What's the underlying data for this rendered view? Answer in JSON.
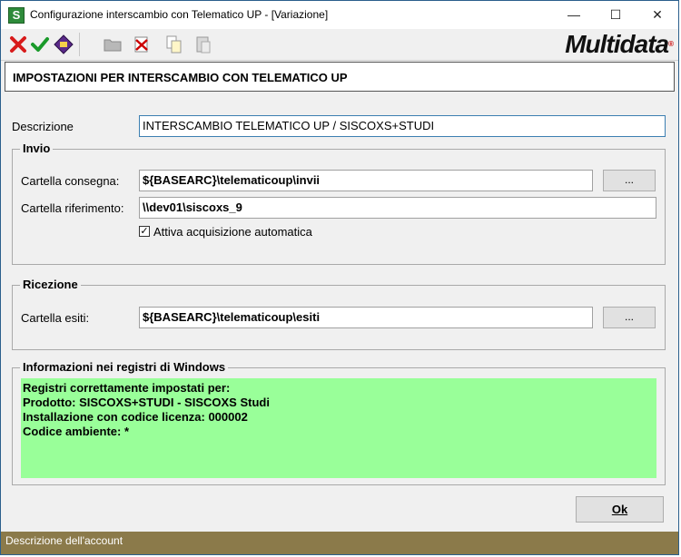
{
  "window": {
    "title": "Configurazione interscambio con Telematico UP - [Variazione]",
    "app_icon": "S",
    "minimize_glyph": "—",
    "maximize_glyph": "☐",
    "close_glyph": "✕"
  },
  "toolbar": {
    "icons": [
      "cancel-icon",
      "confirm-icon",
      "edit-icon",
      "folder-icon",
      "delete-icon",
      "copy-icon",
      "paste-icon"
    ],
    "logo": "Multidata",
    "logo_reg": "®"
  },
  "header": {
    "title": "IMPOSTAZIONI PER INTERSCAMBIO CON TELEMATICO UP"
  },
  "descrizione": {
    "label": "Descrizione",
    "value": "INTERSCAMBIO TELEMATICO UP / SISCOXS+STUDI"
  },
  "invio": {
    "title": "Invio",
    "consegna_label": "Cartella consegna:",
    "consegna_value": "${BASEARC}\\telematicoup\\invii",
    "browse_label": "...",
    "riferimento_label": "Cartella riferimento:",
    "riferimento_value": "\\\\dev01\\siscoxs_9",
    "auto_label": "Attiva acquisizione automatica",
    "auto_checked": true
  },
  "ricezione": {
    "title": "Ricezione",
    "esiti_label": "Cartella esiti:",
    "esiti_value": "${BASEARC}\\telematicoup\\esiti",
    "browse_label": "..."
  },
  "registri": {
    "title": "Informazioni nei registri di Windows",
    "lines": [
      "Registri correttamente impostati per:",
      "Prodotto: SISCOXS+STUDI - SISCOXS Studi",
      "Installazione con codice licenza: 000002",
      "Codice ambiente: *"
    ],
    "bg_color": "#99ff99"
  },
  "ok_button": {
    "label": "Ok"
  },
  "status": {
    "text": "Descrizione dell'account"
  },
  "colors": {
    "status_bar": "#8b7a4a",
    "accent": "#2b5f8c"
  }
}
